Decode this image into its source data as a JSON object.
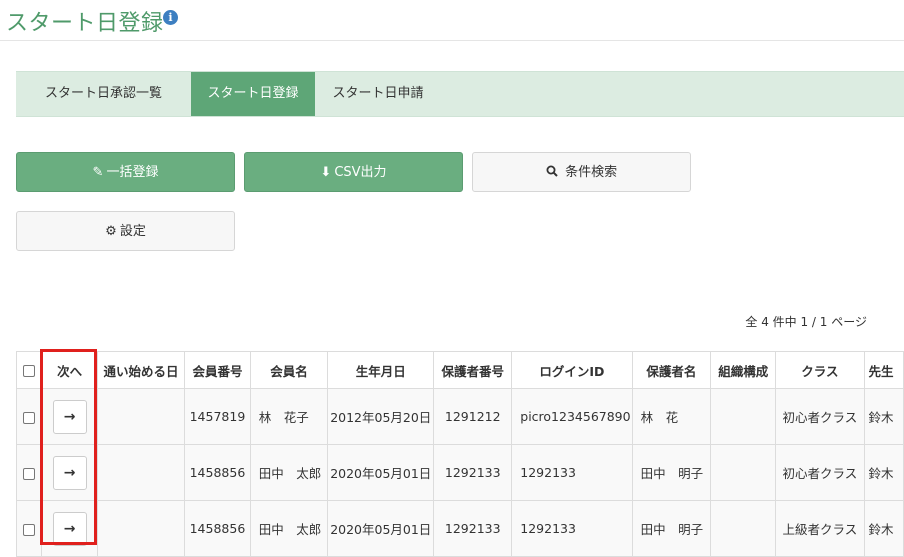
{
  "header": {
    "title": "スタート日登録",
    "info_icon": "i"
  },
  "tabs": [
    {
      "label": "スタート日承認一覧"
    },
    {
      "label": "スタート日登録",
      "active": true
    },
    {
      "label": "スタート日申請"
    }
  ],
  "toolbar": {
    "bulk_label": "一括登録",
    "csv_label": "CSV出力",
    "search_label": "条件検索",
    "settings_label": "設定"
  },
  "icons": {
    "bulk": "pencil-icon",
    "csv": "download-icon",
    "search": "search-icon",
    "settings": "gear-icon",
    "next": "arrow-right-icon"
  },
  "pagination": {
    "summary": "全 4 件中 1 / 1 ページ"
  },
  "table": {
    "columns": [
      "次へ",
      "通い始める日",
      "会員番号",
      "会員名",
      "生年月日",
      "保護者番号",
      "ログインID",
      "保護者名",
      "組織構成",
      "クラス",
      "先生"
    ],
    "rows": [
      {
        "start_date": "",
        "member_no": "1457819",
        "member_name": "林　花子",
        "birth": "2012年05月20日",
        "guardian_no": "1291212",
        "login_id": "picro1234567890",
        "guardian_name": "林　花",
        "org": "",
        "class": "初心者クラス",
        "teacher": "鈴木"
      },
      {
        "start_date": "",
        "member_no": "1458856",
        "member_name": "田中　太郎",
        "birth": "2020年05月01日",
        "guardian_no": "1292133",
        "login_id": "1292133",
        "guardian_name": "田中　明子",
        "org": "",
        "class": "初心者クラス",
        "teacher": "鈴木"
      },
      {
        "start_date": "",
        "member_no": "1458856",
        "member_name": "田中　太郎",
        "birth": "2020年05月01日",
        "guardian_no": "1292133",
        "login_id": "1292133",
        "guardian_name": "田中　明子",
        "org": "",
        "class": "上級者クラス",
        "teacher": "鈴木"
      }
    ]
  },
  "colors": {
    "accent": "#5ea677",
    "tab_bg": "#dcece1",
    "highlight": "#e0201d",
    "title": "#4f9a6a"
  }
}
